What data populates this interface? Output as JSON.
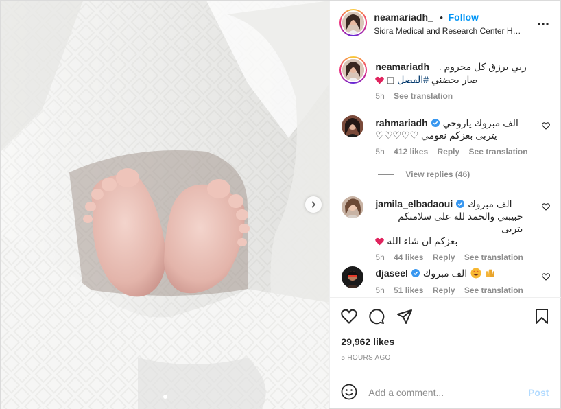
{
  "header": {
    "username": "neamariadh_",
    "separator": "•",
    "follow_label": "Follow",
    "location": "Sidra Medical and Research Center Ho..."
  },
  "caption": {
    "username": "neamariadh_",
    "line1": "ربي يرزق كل محروم .",
    "hashtag": "#الفضل",
    "line2_rest": "صار بحضني",
    "time": "5h",
    "see_translation": "See translation"
  },
  "comments": [
    {
      "username": "rahmariadh",
      "verified": true,
      "lines": [
        "الف مبروك ياروحي",
        "يتربى بعزكم نعومي ♡♡♡♡♡"
      ],
      "time": "5h",
      "likes": "412 likes",
      "reply": "Reply",
      "see_translation": "See translation"
    },
    {
      "username": "jamila_elbadaoui",
      "verified": true,
      "lines": [
        "الف مبروك",
        "حبيبتي والحمد لله على سلامتكم يتربى",
        "بعزكم ان شاء الله"
      ],
      "time": "5h",
      "likes": "44 likes",
      "reply": "Reply",
      "see_translation": "See translation"
    },
    {
      "username": "djaseel",
      "verified": true,
      "lines": [
        "الف مبروك"
      ],
      "time": "5h",
      "likes": "51 likes",
      "reply": "Reply",
      "see_translation": "See translation"
    }
  ],
  "view_replies": "View replies (46)",
  "stats": {
    "likes": "29,962 likes",
    "posted": "5 HOURS AGO"
  },
  "composer": {
    "placeholder": "Add a comment...",
    "post_label": "Post"
  },
  "colors": {
    "accent": "#0095f6",
    "verified": "#3897f0",
    "heart": "#ed4956"
  },
  "icons": [
    "chevron-right-icon",
    "more-icon",
    "heart-icon",
    "comment-icon",
    "share-icon",
    "bookmark-icon",
    "emoji-icon",
    "verified-icon"
  ]
}
